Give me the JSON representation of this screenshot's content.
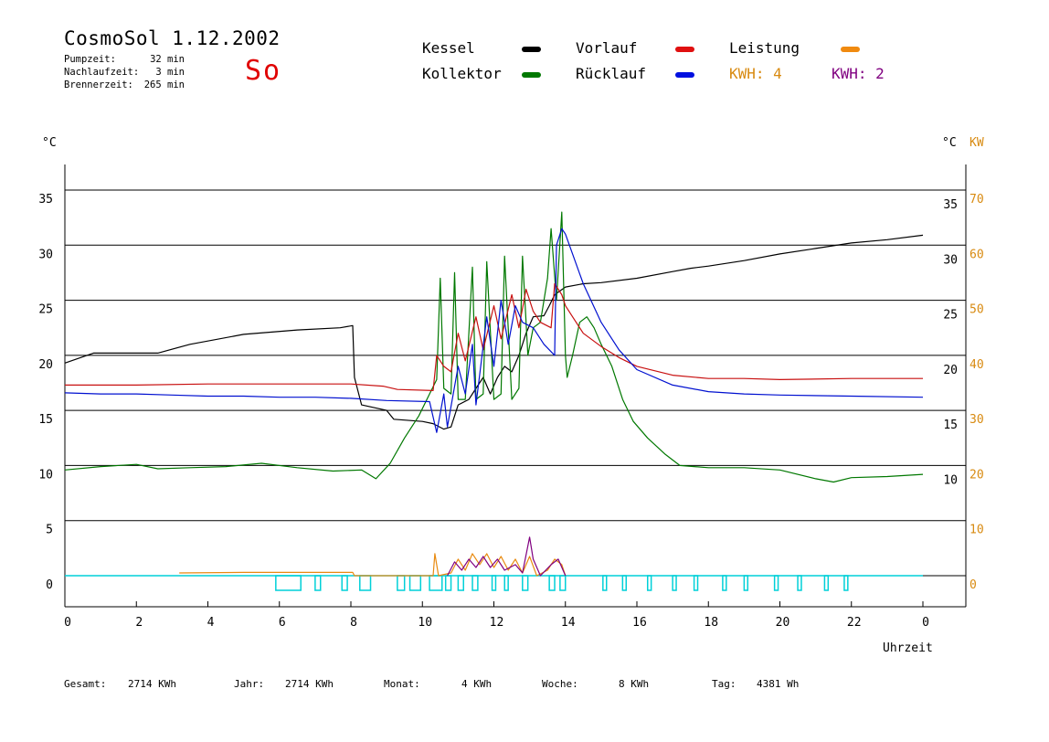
{
  "header": {
    "title": "CosmoSol 1.12.2002",
    "day": "So",
    "info": [
      {
        "label": "Pumpzeit:",
        "value": "32 min"
      },
      {
        "label": "Nachlaufzeit:",
        "value": "3 min"
      },
      {
        "label": "Brennerzeit:",
        "value": "265 min"
      }
    ]
  },
  "legend": {
    "kessel": "Kessel",
    "kollektor": "Kollektor",
    "vorlauf": "Vorlauf",
    "ruecklauf": "Rücklauf",
    "leistung": "Leistung",
    "kwh_a": "KWH: 4",
    "kwh_b": "KWH: 2"
  },
  "axis": {
    "left_unit": "°C",
    "right_unit_c": "°C",
    "right_unit_kw": "KW",
    "xlabel": "Uhrzeit"
  },
  "footer": {
    "gesamt_label": "Gesamt:",
    "gesamt_value": "2714 KWh",
    "jahr_label": "Jahr:",
    "jahr_value": "2714 KWh",
    "monat_label": "Monat:",
    "monat_value": "4 KWh",
    "woche_label": "Woche:",
    "woche_value": "8 KWh",
    "tag_label": "Tag:",
    "tag_value": "4381 Wh"
  },
  "colors": {
    "kessel": "#000000",
    "kollektor": "#007800",
    "vorlauf": "#c81010",
    "ruecklauf": "#0010d0",
    "leistung": "#e88a10",
    "kwh_b": "#800080",
    "pump": "#00d0d8",
    "grid": "#000000",
    "kw_axis": "#d88a10"
  },
  "chart_data": {
    "type": "line",
    "xlabel": "Uhrzeit",
    "ylabel": "°C",
    "y2label": "KW",
    "xlim": [
      0,
      24
    ],
    "ylim": [
      -3,
      38
    ],
    "y2lim": [
      -6,
      76
    ],
    "x_ticks": [
      "0",
      "2",
      "4",
      "6",
      "8",
      "10",
      "12",
      "14",
      "16",
      "18",
      "20",
      "22",
      "0"
    ],
    "x_tick_values": [
      0,
      2,
      4,
      6,
      8,
      10,
      12,
      14,
      16,
      18,
      20,
      22,
      24
    ],
    "y_ticks": [
      0,
      5,
      10,
      15,
      20,
      25,
      30,
      35
    ],
    "y_ticks_right": [
      10,
      15,
      20,
      25,
      30,
      35
    ],
    "y2_ticks": [
      0,
      10,
      20,
      30,
      40,
      50,
      60,
      70
    ],
    "series": [
      {
        "name": "Kessel",
        "color": "#000000",
        "points": [
          [
            0,
            19.3
          ],
          [
            0.8,
            20.2
          ],
          [
            2.6,
            20.2
          ],
          [
            3.5,
            21.0
          ],
          [
            5,
            21.9
          ],
          [
            6.5,
            22.3
          ],
          [
            7.7,
            22.5
          ],
          [
            8.05,
            22.7
          ],
          [
            8.1,
            18
          ],
          [
            8.3,
            15.5
          ],
          [
            9.0,
            15.0
          ],
          [
            9.2,
            14.2
          ],
          [
            10,
            14.0
          ],
          [
            10.3,
            13.8
          ],
          [
            10.6,
            13.3
          ],
          [
            10.8,
            13.5
          ],
          [
            11,
            15.5
          ],
          [
            11.3,
            16
          ],
          [
            11.5,
            17
          ],
          [
            11.7,
            18
          ],
          [
            11.9,
            16.5
          ],
          [
            12.1,
            18
          ],
          [
            12.3,
            19
          ],
          [
            12.5,
            18.5
          ],
          [
            12.7,
            20
          ],
          [
            12.9,
            22
          ],
          [
            13.1,
            23.5
          ],
          [
            13.4,
            23.6
          ],
          [
            13.55,
            24.5
          ],
          [
            13.7,
            25.5
          ],
          [
            14.0,
            26.2
          ],
          [
            14.5,
            26.5
          ],
          [
            15.0,
            26.6
          ],
          [
            16,
            27.0
          ],
          [
            17,
            27.6
          ],
          [
            17.5,
            27.9
          ],
          [
            18,
            28.1
          ],
          [
            19,
            28.6
          ],
          [
            20,
            29.2
          ],
          [
            21,
            29.7
          ],
          [
            22,
            30.2
          ],
          [
            23,
            30.5
          ],
          [
            24,
            30.9
          ]
        ]
      },
      {
        "name": "Kollektor",
        "color": "#007800",
        "points": [
          [
            0,
            9.6
          ],
          [
            1,
            9.9
          ],
          [
            2,
            10.1
          ],
          [
            2.6,
            9.7
          ],
          [
            3.5,
            9.8
          ],
          [
            4.5,
            9.9
          ],
          [
            5.5,
            10.2
          ],
          [
            6.5,
            9.8
          ],
          [
            7.5,
            9.5
          ],
          [
            8.3,
            9.6
          ],
          [
            8.7,
            8.8
          ],
          [
            9.1,
            10.2
          ],
          [
            9.5,
            12.5
          ],
          [
            9.9,
            14.5
          ],
          [
            10.2,
            16.5
          ],
          [
            10.4,
            17.8
          ],
          [
            10.5,
            27
          ],
          [
            10.6,
            17
          ],
          [
            10.8,
            16.5
          ],
          [
            10.9,
            27.5
          ],
          [
            11.0,
            16
          ],
          [
            11.2,
            16
          ],
          [
            11.4,
            28
          ],
          [
            11.5,
            16
          ],
          [
            11.7,
            16.5
          ],
          [
            11.8,
            28.5
          ],
          [
            12.0,
            16
          ],
          [
            12.2,
            16.5
          ],
          [
            12.3,
            29
          ],
          [
            12.5,
            16
          ],
          [
            12.7,
            17
          ],
          [
            12.8,
            29
          ],
          [
            12.95,
            20
          ],
          [
            13.1,
            22.5
          ],
          [
            13.3,
            23
          ],
          [
            13.5,
            27
          ],
          [
            13.6,
            31.5
          ],
          [
            13.75,
            25
          ],
          [
            13.9,
            33
          ],
          [
            14.0,
            20
          ],
          [
            14.05,
            18
          ],
          [
            14.2,
            20
          ],
          [
            14.4,
            23
          ],
          [
            14.6,
            23.5
          ],
          [
            14.8,
            22.5
          ],
          [
            15.0,
            21
          ],
          [
            15.3,
            19
          ],
          [
            15.6,
            16
          ],
          [
            15.9,
            14
          ],
          [
            16.3,
            12.5
          ],
          [
            16.8,
            11
          ],
          [
            17.2,
            10
          ],
          [
            18,
            9.8
          ],
          [
            19,
            9.8
          ],
          [
            20,
            9.6
          ],
          [
            21,
            8.8
          ],
          [
            21.5,
            8.5
          ],
          [
            22,
            8.9
          ],
          [
            23,
            9.0
          ],
          [
            24,
            9.2
          ]
        ]
      },
      {
        "name": "Vorlauf",
        "color": "#c81010",
        "points": [
          [
            0,
            17.3
          ],
          [
            2,
            17.3
          ],
          [
            4,
            17.4
          ],
          [
            6,
            17.4
          ],
          [
            8,
            17.4
          ],
          [
            8.9,
            17.2
          ],
          [
            9.3,
            16.9
          ],
          [
            10.3,
            16.8
          ],
          [
            10.4,
            20
          ],
          [
            10.6,
            19
          ],
          [
            10.8,
            18.5
          ],
          [
            11,
            22
          ],
          [
            11.2,
            19.5
          ],
          [
            11.5,
            23.5
          ],
          [
            11.7,
            20.5
          ],
          [
            12,
            24.5
          ],
          [
            12.2,
            21.5
          ],
          [
            12.5,
            25.5
          ],
          [
            12.7,
            22.5
          ],
          [
            12.9,
            26
          ],
          [
            13.1,
            24
          ],
          [
            13.3,
            23
          ],
          [
            13.6,
            22.5
          ],
          [
            13.7,
            26.5
          ],
          [
            13.9,
            25.5
          ],
          [
            14.0,
            24.5
          ],
          [
            14.2,
            23.5
          ],
          [
            14.5,
            22
          ],
          [
            15,
            20.8
          ],
          [
            15.5,
            19.8
          ],
          [
            16,
            19.0
          ],
          [
            17,
            18.2
          ],
          [
            18,
            17.9
          ],
          [
            19,
            17.9
          ],
          [
            20,
            17.8
          ],
          [
            22,
            17.9
          ],
          [
            24,
            17.9
          ]
        ]
      },
      {
        "name": "Rücklauf",
        "color": "#0010d0",
        "points": [
          [
            0,
            16.6
          ],
          [
            1,
            16.5
          ],
          [
            2,
            16.5
          ],
          [
            3,
            16.4
          ],
          [
            4,
            16.3
          ],
          [
            5,
            16.3
          ],
          [
            6,
            16.2
          ],
          [
            7,
            16.2
          ],
          [
            8,
            16.1
          ],
          [
            9.0,
            15.9
          ],
          [
            10.2,
            15.8
          ],
          [
            10.4,
            13
          ],
          [
            10.6,
            16.5
          ],
          [
            10.7,
            13.5
          ],
          [
            11.0,
            19
          ],
          [
            11.2,
            16.5
          ],
          [
            11.4,
            21
          ],
          [
            11.5,
            15.5
          ],
          [
            11.8,
            23.5
          ],
          [
            12.0,
            19
          ],
          [
            12.2,
            25
          ],
          [
            12.4,
            21
          ],
          [
            12.6,
            24.5
          ],
          [
            12.8,
            23
          ],
          [
            13.1,
            22.5
          ],
          [
            13.4,
            21
          ],
          [
            13.7,
            20
          ],
          [
            13.75,
            30
          ],
          [
            13.9,
            31.5
          ],
          [
            14.0,
            31
          ],
          [
            14.5,
            26.5
          ],
          [
            15,
            23
          ],
          [
            15.5,
            20.5
          ],
          [
            16,
            18.7
          ],
          [
            17,
            17.3
          ],
          [
            18,
            16.7
          ],
          [
            19,
            16.5
          ],
          [
            20,
            16.4
          ],
          [
            22,
            16.3
          ],
          [
            24,
            16.2
          ]
        ]
      },
      {
        "name": "Leistung",
        "color": "#e88a10",
        "axis": "right",
        "points": [
          [
            3.2,
            0.5
          ],
          [
            5,
            0.6
          ],
          [
            6.5,
            0.6
          ],
          [
            8.05,
            0.6
          ],
          [
            8.1,
            0
          ],
          [
            10.3,
            0
          ],
          [
            10.35,
            4
          ],
          [
            10.45,
            0
          ],
          [
            10.8,
            0.5
          ],
          [
            11.0,
            3
          ],
          [
            11.2,
            1
          ],
          [
            11.4,
            4
          ],
          [
            11.6,
            2
          ],
          [
            11.8,
            4
          ],
          [
            12.0,
            1.5
          ],
          [
            12.2,
            3.5
          ],
          [
            12.4,
            1
          ],
          [
            12.6,
            3
          ],
          [
            12.8,
            0.5
          ],
          [
            13.0,
            3.5
          ],
          [
            13.2,
            0
          ],
          [
            13.5,
            1
          ],
          [
            13.7,
            3
          ],
          [
            13.9,
            2
          ],
          [
            14.0,
            0
          ]
        ]
      },
      {
        "name": "KWH: 2",
        "color": "#800080",
        "axis": "right",
        "points": [
          [
            10.7,
            0
          ],
          [
            10.9,
            2.5
          ],
          [
            11.1,
            1
          ],
          [
            11.3,
            3
          ],
          [
            11.5,
            1.5
          ],
          [
            11.7,
            3.5
          ],
          [
            11.9,
            1.5
          ],
          [
            12.1,
            3
          ],
          [
            12.3,
            1
          ],
          [
            12.6,
            2
          ],
          [
            12.8,
            0.5
          ],
          [
            13.0,
            7
          ],
          [
            13.1,
            3
          ],
          [
            13.3,
            0
          ],
          [
            13.6,
            2
          ],
          [
            13.8,
            3
          ],
          [
            14.0,
            0
          ]
        ]
      }
    ],
    "pump_intervals": [
      [
        5.9,
        6.6
      ],
      [
        7.0,
        7.15
      ],
      [
        7.75,
        7.9
      ],
      [
        8.25,
        8.55
      ],
      [
        9.3,
        9.5
      ],
      [
        9.65,
        9.95
      ],
      [
        10.2,
        10.55
      ],
      [
        10.65,
        10.8
      ],
      [
        11.0,
        11.15
      ],
      [
        11.4,
        11.55
      ],
      [
        11.95,
        12.05
      ],
      [
        12.3,
        12.4
      ],
      [
        12.8,
        12.95
      ],
      [
        13.55,
        13.7
      ],
      [
        13.85,
        14.0
      ],
      [
        15.05,
        15.15
      ],
      [
        15.6,
        15.7
      ],
      [
        16.3,
        16.4
      ],
      [
        17.0,
        17.1
      ],
      [
        17.6,
        17.7
      ],
      [
        18.4,
        18.5
      ],
      [
        19.0,
        19.1
      ],
      [
        19.85,
        19.95
      ],
      [
        20.5,
        20.6
      ],
      [
        21.25,
        21.35
      ],
      [
        21.8,
        21.9
      ]
    ]
  }
}
